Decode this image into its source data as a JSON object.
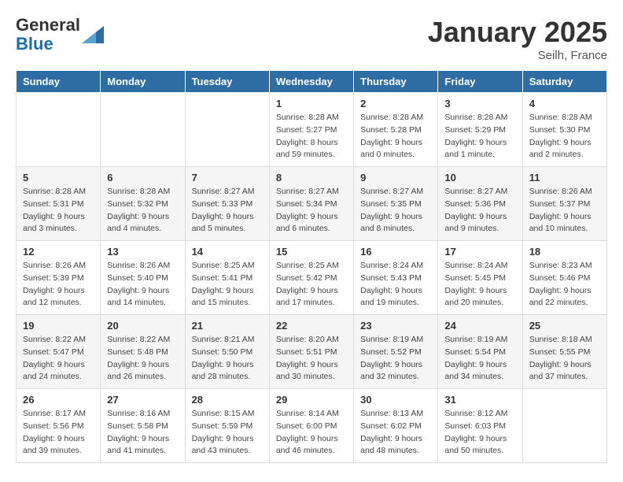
{
  "header": {
    "logo_general": "General",
    "logo_blue": "Blue",
    "month_title": "January 2025",
    "location": "Seilh, France"
  },
  "days_of_week": [
    "Sunday",
    "Monday",
    "Tuesday",
    "Wednesday",
    "Thursday",
    "Friday",
    "Saturday"
  ],
  "weeks": [
    [
      {
        "day": "",
        "info": ""
      },
      {
        "day": "",
        "info": ""
      },
      {
        "day": "",
        "info": ""
      },
      {
        "day": "1",
        "info": "Sunrise: 8:28 AM\nSunset: 5:27 PM\nDaylight: 8 hours\nand 59 minutes."
      },
      {
        "day": "2",
        "info": "Sunrise: 8:28 AM\nSunset: 5:28 PM\nDaylight: 9 hours\nand 0 minutes."
      },
      {
        "day": "3",
        "info": "Sunrise: 8:28 AM\nSunset: 5:29 PM\nDaylight: 9 hours\nand 1 minute."
      },
      {
        "day": "4",
        "info": "Sunrise: 8:28 AM\nSunset: 5:30 PM\nDaylight: 9 hours\nand 2 minutes."
      }
    ],
    [
      {
        "day": "5",
        "info": "Sunrise: 8:28 AM\nSunset: 5:31 PM\nDaylight: 9 hours\nand 3 minutes."
      },
      {
        "day": "6",
        "info": "Sunrise: 8:28 AM\nSunset: 5:32 PM\nDaylight: 9 hours\nand 4 minutes."
      },
      {
        "day": "7",
        "info": "Sunrise: 8:27 AM\nSunset: 5:33 PM\nDaylight: 9 hours\nand 5 minutes."
      },
      {
        "day": "8",
        "info": "Sunrise: 8:27 AM\nSunset: 5:34 PM\nDaylight: 9 hours\nand 6 minutes."
      },
      {
        "day": "9",
        "info": "Sunrise: 8:27 AM\nSunset: 5:35 PM\nDaylight: 9 hours\nand 8 minutes."
      },
      {
        "day": "10",
        "info": "Sunrise: 8:27 AM\nSunset: 5:36 PM\nDaylight: 9 hours\nand 9 minutes."
      },
      {
        "day": "11",
        "info": "Sunrise: 8:26 AM\nSunset: 5:37 PM\nDaylight: 9 hours\nand 10 minutes."
      }
    ],
    [
      {
        "day": "12",
        "info": "Sunrise: 8:26 AM\nSunset: 5:39 PM\nDaylight: 9 hours\nand 12 minutes."
      },
      {
        "day": "13",
        "info": "Sunrise: 8:26 AM\nSunset: 5:40 PM\nDaylight: 9 hours\nand 14 minutes."
      },
      {
        "day": "14",
        "info": "Sunrise: 8:25 AM\nSunset: 5:41 PM\nDaylight: 9 hours\nand 15 minutes."
      },
      {
        "day": "15",
        "info": "Sunrise: 8:25 AM\nSunset: 5:42 PM\nDaylight: 9 hours\nand 17 minutes."
      },
      {
        "day": "16",
        "info": "Sunrise: 8:24 AM\nSunset: 5:43 PM\nDaylight: 9 hours\nand 19 minutes."
      },
      {
        "day": "17",
        "info": "Sunrise: 8:24 AM\nSunset: 5:45 PM\nDaylight: 9 hours\nand 20 minutes."
      },
      {
        "day": "18",
        "info": "Sunrise: 8:23 AM\nSunset: 5:46 PM\nDaylight: 9 hours\nand 22 minutes."
      }
    ],
    [
      {
        "day": "19",
        "info": "Sunrise: 8:22 AM\nSunset: 5:47 PM\nDaylight: 9 hours\nand 24 minutes."
      },
      {
        "day": "20",
        "info": "Sunrise: 8:22 AM\nSunset: 5:48 PM\nDaylight: 9 hours\nand 26 minutes."
      },
      {
        "day": "21",
        "info": "Sunrise: 8:21 AM\nSunset: 5:50 PM\nDaylight: 9 hours\nand 28 minutes."
      },
      {
        "day": "22",
        "info": "Sunrise: 8:20 AM\nSunset: 5:51 PM\nDaylight: 9 hours\nand 30 minutes."
      },
      {
        "day": "23",
        "info": "Sunrise: 8:19 AM\nSunset: 5:52 PM\nDaylight: 9 hours\nand 32 minutes."
      },
      {
        "day": "24",
        "info": "Sunrise: 8:19 AM\nSunset: 5:54 PM\nDaylight: 9 hours\nand 34 minutes."
      },
      {
        "day": "25",
        "info": "Sunrise: 8:18 AM\nSunset: 5:55 PM\nDaylight: 9 hours\nand 37 minutes."
      }
    ],
    [
      {
        "day": "26",
        "info": "Sunrise: 8:17 AM\nSunset: 5:56 PM\nDaylight: 9 hours\nand 39 minutes."
      },
      {
        "day": "27",
        "info": "Sunrise: 8:16 AM\nSunset: 5:58 PM\nDaylight: 9 hours\nand 41 minutes."
      },
      {
        "day": "28",
        "info": "Sunrise: 8:15 AM\nSunset: 5:59 PM\nDaylight: 9 hours\nand 43 minutes."
      },
      {
        "day": "29",
        "info": "Sunrise: 8:14 AM\nSunset: 6:00 PM\nDaylight: 9 hours\nand 46 minutes."
      },
      {
        "day": "30",
        "info": "Sunrise: 8:13 AM\nSunset: 6:02 PM\nDaylight: 9 hours\nand 48 minutes."
      },
      {
        "day": "31",
        "info": "Sunrise: 8:12 AM\nSunset: 6:03 PM\nDaylight: 9 hours\nand 50 minutes."
      },
      {
        "day": "",
        "info": ""
      }
    ]
  ]
}
